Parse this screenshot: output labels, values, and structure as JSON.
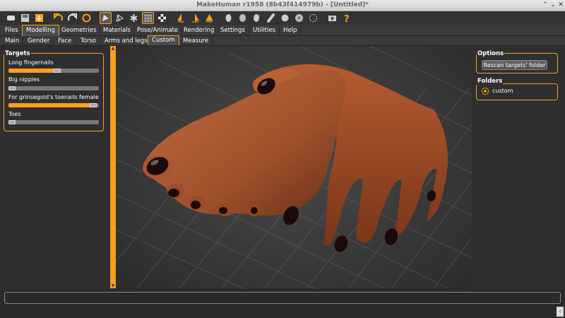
{
  "window": {
    "title": "MakeHuman r1958 (8b43f414979b) - [Untitled]*",
    "controls": [
      "⌃",
      "⌄",
      "✕"
    ]
  },
  "toolbar": {
    "icons": [
      "new-icon",
      "save-icon",
      "export-icon",
      "undo-icon",
      "redo-icon",
      "reset-icon",
      "smooth-icon",
      "wireframe-icon",
      "pose-icon",
      "grid-icon",
      "checker-icon",
      "front-view-icon",
      "back-view-icon",
      "left-view-icon",
      "right-view-icon",
      "top-view-icon",
      "bottom-view-icon",
      "reset-camera-icon",
      "screenshot-icon",
      "help-icon"
    ]
  },
  "main_tabs": [
    "Files",
    "Modelling",
    "Geometries",
    "Materials",
    "Pose/Animate",
    "Rendering",
    "Settings",
    "Utilities",
    "Help"
  ],
  "active_main_tab": "Modelling",
  "sub_tabs": [
    "Main",
    "Gender",
    "Face",
    "Torso",
    "Arms and legs",
    "Custom",
    "Measure"
  ],
  "active_sub_tab": "Custom",
  "targets": {
    "title": "Targets",
    "sliders": [
      {
        "label": "Long fingernails",
        "value": 0.5
      },
      {
        "label": "Big nipples",
        "value": 0.0
      },
      {
        "label": "For grinsegold's toenails female",
        "value": 0.9
      },
      {
        "label": "Toes",
        "value": 0.0
      }
    ]
  },
  "options": {
    "title": "Options",
    "rescan_button": "Rescan targets' folder"
  },
  "folders": {
    "title": "Folders",
    "items": [
      {
        "label": "custom",
        "selected": true
      }
    ]
  },
  "colors": {
    "accent": "#f7a01f",
    "skin": "#a0522d",
    "nail": "#1a0a0a"
  }
}
